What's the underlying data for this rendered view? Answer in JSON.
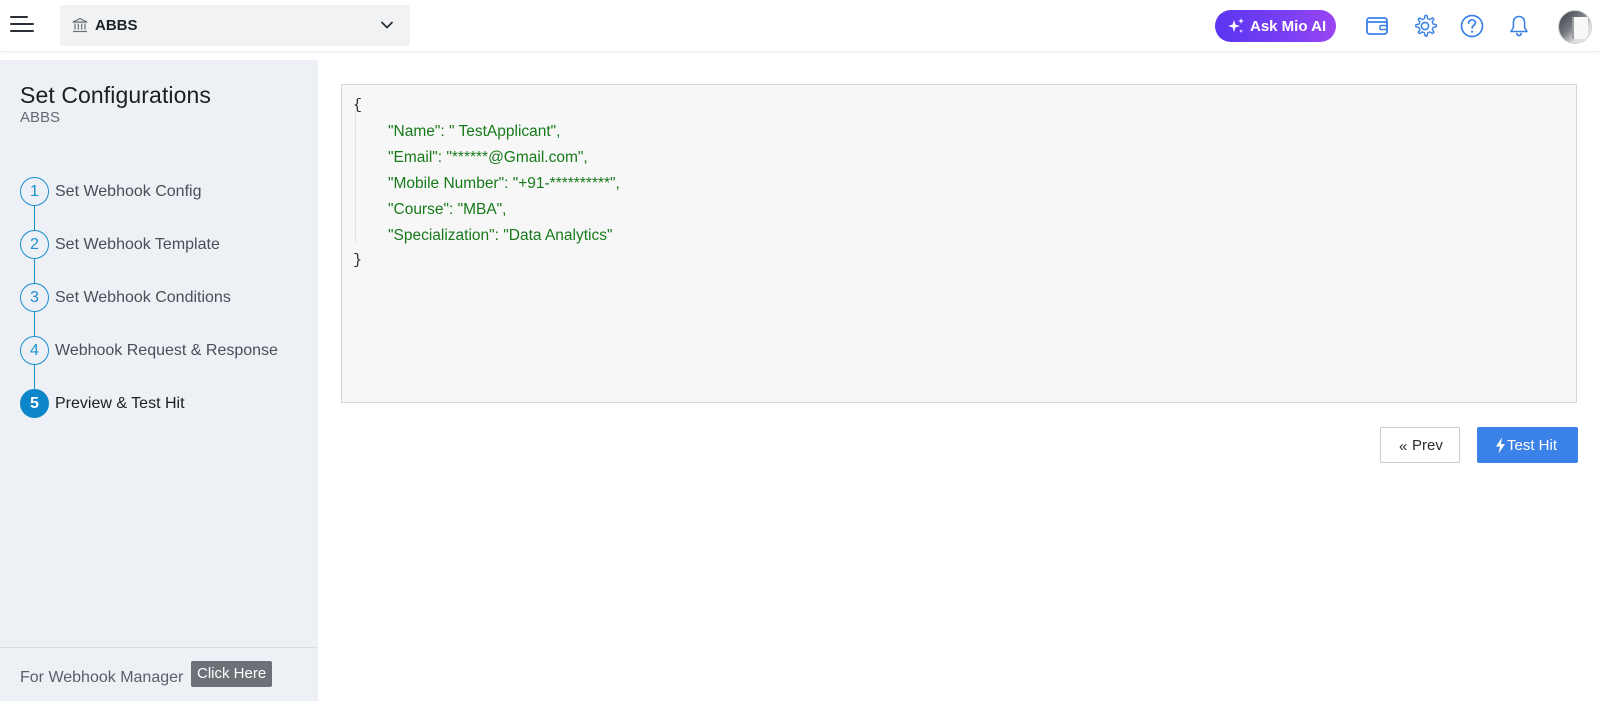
{
  "header": {
    "org_name": "ABBS",
    "ask_ai_label": "Ask Mio AI",
    "icons": [
      "menu-icon",
      "bank-icon",
      "chevron-down-icon",
      "sparkle-icon",
      "wallet-icon",
      "gear-icon",
      "help-icon",
      "bell-icon",
      "avatar"
    ],
    "colors": {
      "accent_start": "#5a35f0",
      "accent_end": "#9a45f2",
      "icon_blue": "#3b82e8"
    }
  },
  "sidebar": {
    "title": "Set Configurations",
    "subtitle": "ABBS",
    "steps": [
      {
        "number": "1",
        "label": "Set Webhook Config",
        "active": false
      },
      {
        "number": "2",
        "label": "Set Webhook Template",
        "active": false
      },
      {
        "number": "3",
        "label": "Set Webhook Conditions",
        "active": false
      },
      {
        "number": "4",
        "label": "Webhook Request & Response",
        "active": false
      },
      {
        "number": "5",
        "label": "Preview & Test Hit",
        "active": true
      }
    ],
    "footer_text": "For Webhook Manager",
    "footer_button": "Click Here",
    "colors": {
      "step": "#1c8fd0",
      "active_step": "#0d86c9",
      "background": "#edf0f5"
    }
  },
  "preview": {
    "open_brace": "{",
    "close_brace": "}",
    "lines": [
      "\"Name\": \" TestApplicant\",",
      "\"Email\": \"******@Gmail.com\",",
      "\"Mobile Number\": \"+91-**********\",",
      "\"Course\": \"MBA\",",
      "\"Specialization\": \"Data Analytics\""
    ],
    "colors": {
      "code_text": "#177a1a",
      "panel_bg": "#f7f7f7"
    }
  },
  "actions": {
    "prev_label": "Prev",
    "test_hit_label": "Test Hit",
    "colors": {
      "primary": "#3b82e8"
    }
  }
}
